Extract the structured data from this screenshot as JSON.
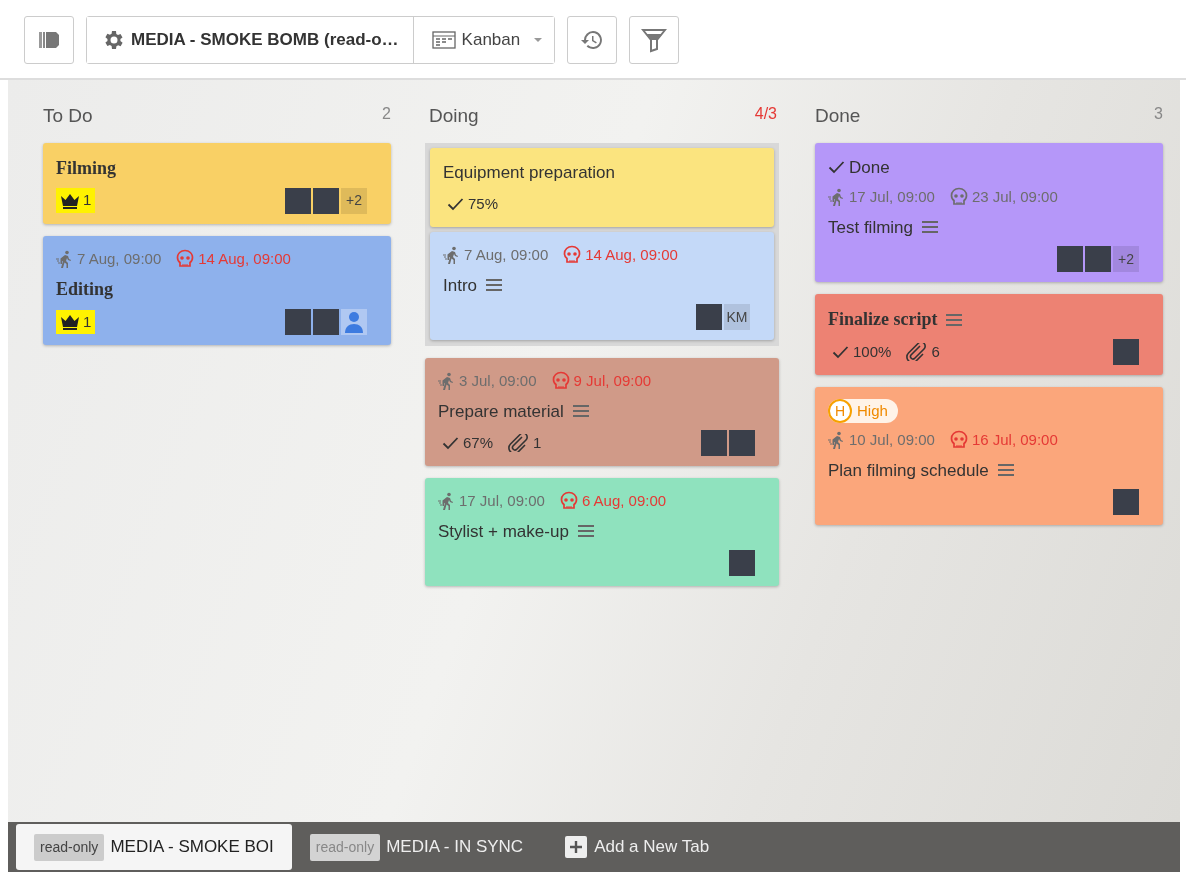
{
  "toolbar": {
    "board_title": "MEDIA - SMOKE BOMB (read-o…",
    "view": "Kanban"
  },
  "columns": [
    {
      "title": "To Do",
      "count": "2",
      "over_limit": false,
      "cards": [
        {
          "color": "#f9d065",
          "title": "Filming",
          "bold": true,
          "outlined": false,
          "has_description": false,
          "crowns": "1",
          "avatars": [
            {
              "kind": "photo"
            },
            {
              "kind": "photo"
            },
            {
              "kind": "more",
              "text": "+2"
            }
          ]
        },
        {
          "color": "#8eb1ec",
          "title": "Editing",
          "bold": true,
          "outlined": false,
          "has_description": false,
          "start": "7 Aug, 09:00",
          "due": "14 Aug, 09:00",
          "overdue": true,
          "crowns": "1",
          "avatars": [
            {
              "kind": "photo"
            },
            {
              "kind": "photo"
            },
            {
              "kind": "generic"
            }
          ]
        }
      ]
    },
    {
      "title": "Doing",
      "count": "4/3",
      "over_limit": true,
      "cards": [
        {
          "color": "#fbe47f",
          "title": "Equipment preparation",
          "bold": false,
          "outlined": true,
          "has_description": false,
          "checklist": "75%"
        },
        {
          "color": "#c4d9f8",
          "title": "Intro",
          "bold": false,
          "outlined": true,
          "has_description": true,
          "start": "7 Aug, 09:00",
          "due": "14 Aug, 09:00",
          "overdue": true,
          "avatars": [
            {
              "kind": "photo"
            },
            {
              "kind": "initials",
              "text": "KM"
            }
          ]
        },
        {
          "color": "#d09a88",
          "title": "Prepare material",
          "bold": false,
          "outlined": false,
          "has_description": true,
          "start": "3 Jul, 09:00",
          "due": "9 Jul, 09:00",
          "overdue": true,
          "checklist": "67%",
          "attachments": "1",
          "avatars": [
            {
              "kind": "photo"
            },
            {
              "kind": "photo"
            }
          ]
        },
        {
          "color": "#8fe2be",
          "title": "Stylist + make-up",
          "bold": false,
          "outlined": false,
          "has_description": true,
          "start": "17 Jul, 09:00",
          "due": "6 Aug, 09:00",
          "overdue": true,
          "avatars": [
            {
              "kind": "photo"
            }
          ]
        }
      ]
    },
    {
      "title": "Done",
      "count": "3",
      "over_limit": false,
      "cards": [
        {
          "color": "#b597f9",
          "title": "Test filming",
          "bold": false,
          "outlined": false,
          "has_description": true,
          "done_label": "Done",
          "start": "17 Jul, 09:00",
          "due": "23 Jul, 09:00",
          "overdue": false,
          "avatars": [
            {
              "kind": "photo"
            },
            {
              "kind": "photo"
            },
            {
              "kind": "more",
              "text": "+2"
            }
          ]
        },
        {
          "color": "#ed8273",
          "title": "Finalize script",
          "bold": true,
          "outlined": false,
          "has_description": true,
          "checklist": "100%",
          "attachments": "6",
          "avatars": [
            {
              "kind": "photo"
            }
          ]
        },
        {
          "color": "#fba67b",
          "title": "Plan filming schedule",
          "bold": false,
          "outlined": false,
          "has_description": true,
          "priority": {
            "letter": "H",
            "label": "High"
          },
          "start": "10 Jul, 09:00",
          "due": "16 Jul, 09:00",
          "overdue": true,
          "avatars": [
            {
              "kind": "photo"
            }
          ]
        }
      ]
    }
  ],
  "tabs": [
    {
      "badge": "read-only",
      "label": "MEDIA - SMOKE BOI",
      "selected": true
    },
    {
      "badge": "read-only",
      "label": "MEDIA - IN SYNC",
      "selected": false
    }
  ],
  "add_tab": "Add a New Tab"
}
